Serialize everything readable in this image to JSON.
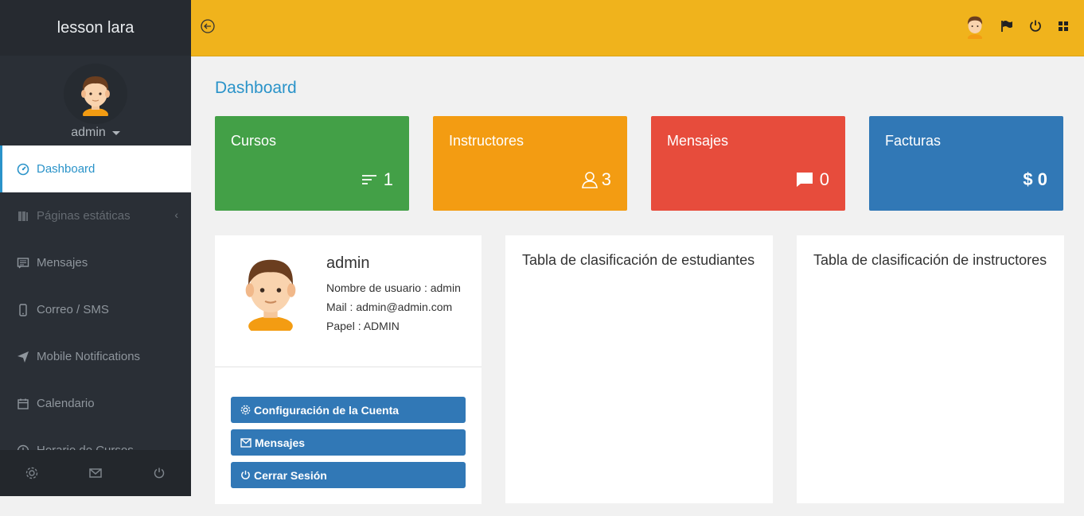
{
  "sidebar": {
    "brand": "lesson lara",
    "user": "admin",
    "items": [
      {
        "label": "Dashboard"
      },
      {
        "label": "Páginas estáticas"
      },
      {
        "label": "Mensajes"
      },
      {
        "label": "Correo / SMS"
      },
      {
        "label": "Mobile Notifications"
      },
      {
        "label": "Calendario"
      },
      {
        "label": "Horario de Cursos"
      }
    ]
  },
  "main": {
    "title": "Dashboard",
    "stats": [
      {
        "label": "Cursos",
        "value": "1",
        "color": "#43a047"
      },
      {
        "label": "Instructores",
        "value": "3",
        "color": "#f39c12"
      },
      {
        "label": "Mensajes",
        "value": "0",
        "color": "#e74c3c"
      },
      {
        "label": "Facturas",
        "value": "$ 0",
        "color": "#3178b6"
      }
    ],
    "profile": {
      "name": "admin",
      "username_line": "Nombre de usuario : admin",
      "mail_line": "Mail : admin@admin.com",
      "role_line": "Papel : ADMIN",
      "buttons": [
        {
          "label": "Configuración de la Cuenta"
        },
        {
          "label": "Mensajes"
        },
        {
          "label": "Cerrar Sesión"
        }
      ]
    },
    "tables": [
      {
        "title": "Tabla de clasificación de estudiantes"
      },
      {
        "title": "Tabla de clasificación de instructores"
      }
    ]
  },
  "colors": {
    "accent": "#2a93c9",
    "topbar": "#f0b31c",
    "sidebar": "#2a2f36"
  }
}
